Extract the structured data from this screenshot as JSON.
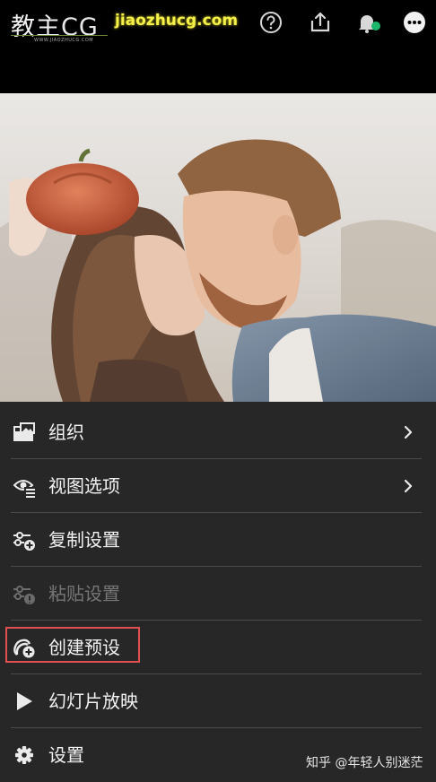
{
  "logo": {
    "text_main": "教主",
    "text_cg": "CG",
    "subtext": "WWW.JIAOZHUCG.COM"
  },
  "site_url": "jiaozhucg.com",
  "top_icons": [
    "help-icon",
    "share-icon",
    "notification-bell-icon",
    "more-options-icon"
  ],
  "photo": {
    "description_icon": "photo"
  },
  "menu": {
    "items": [
      {
        "label": "组织",
        "icon": "folder-image-icon",
        "chevron": true,
        "disabled": false
      },
      {
        "label": "视图选项",
        "icon": "eye-list-icon",
        "chevron": true,
        "disabled": false
      },
      {
        "label": "复制设置",
        "icon": "sliders-add-icon",
        "chevron": false,
        "disabled": false
      },
      {
        "label": "粘贴设置",
        "icon": "sliders-paste-icon",
        "chevron": false,
        "disabled": true
      },
      {
        "label": "创建预设",
        "icon": "preset-add-icon",
        "chevron": false,
        "disabled": false,
        "highlighted": true
      },
      {
        "label": "幻灯片放映",
        "icon": "play-icon",
        "chevron": false,
        "disabled": false
      },
      {
        "label": "设置",
        "icon": "gear-icon",
        "chevron": false,
        "disabled": false
      }
    ]
  },
  "watermark": "知乎 @年轻人别迷茫",
  "colors": {
    "menu_bg": "#272727",
    "highlight": "#e0504e",
    "badge": "#1db56a",
    "site_text": "#f7f24a"
  }
}
